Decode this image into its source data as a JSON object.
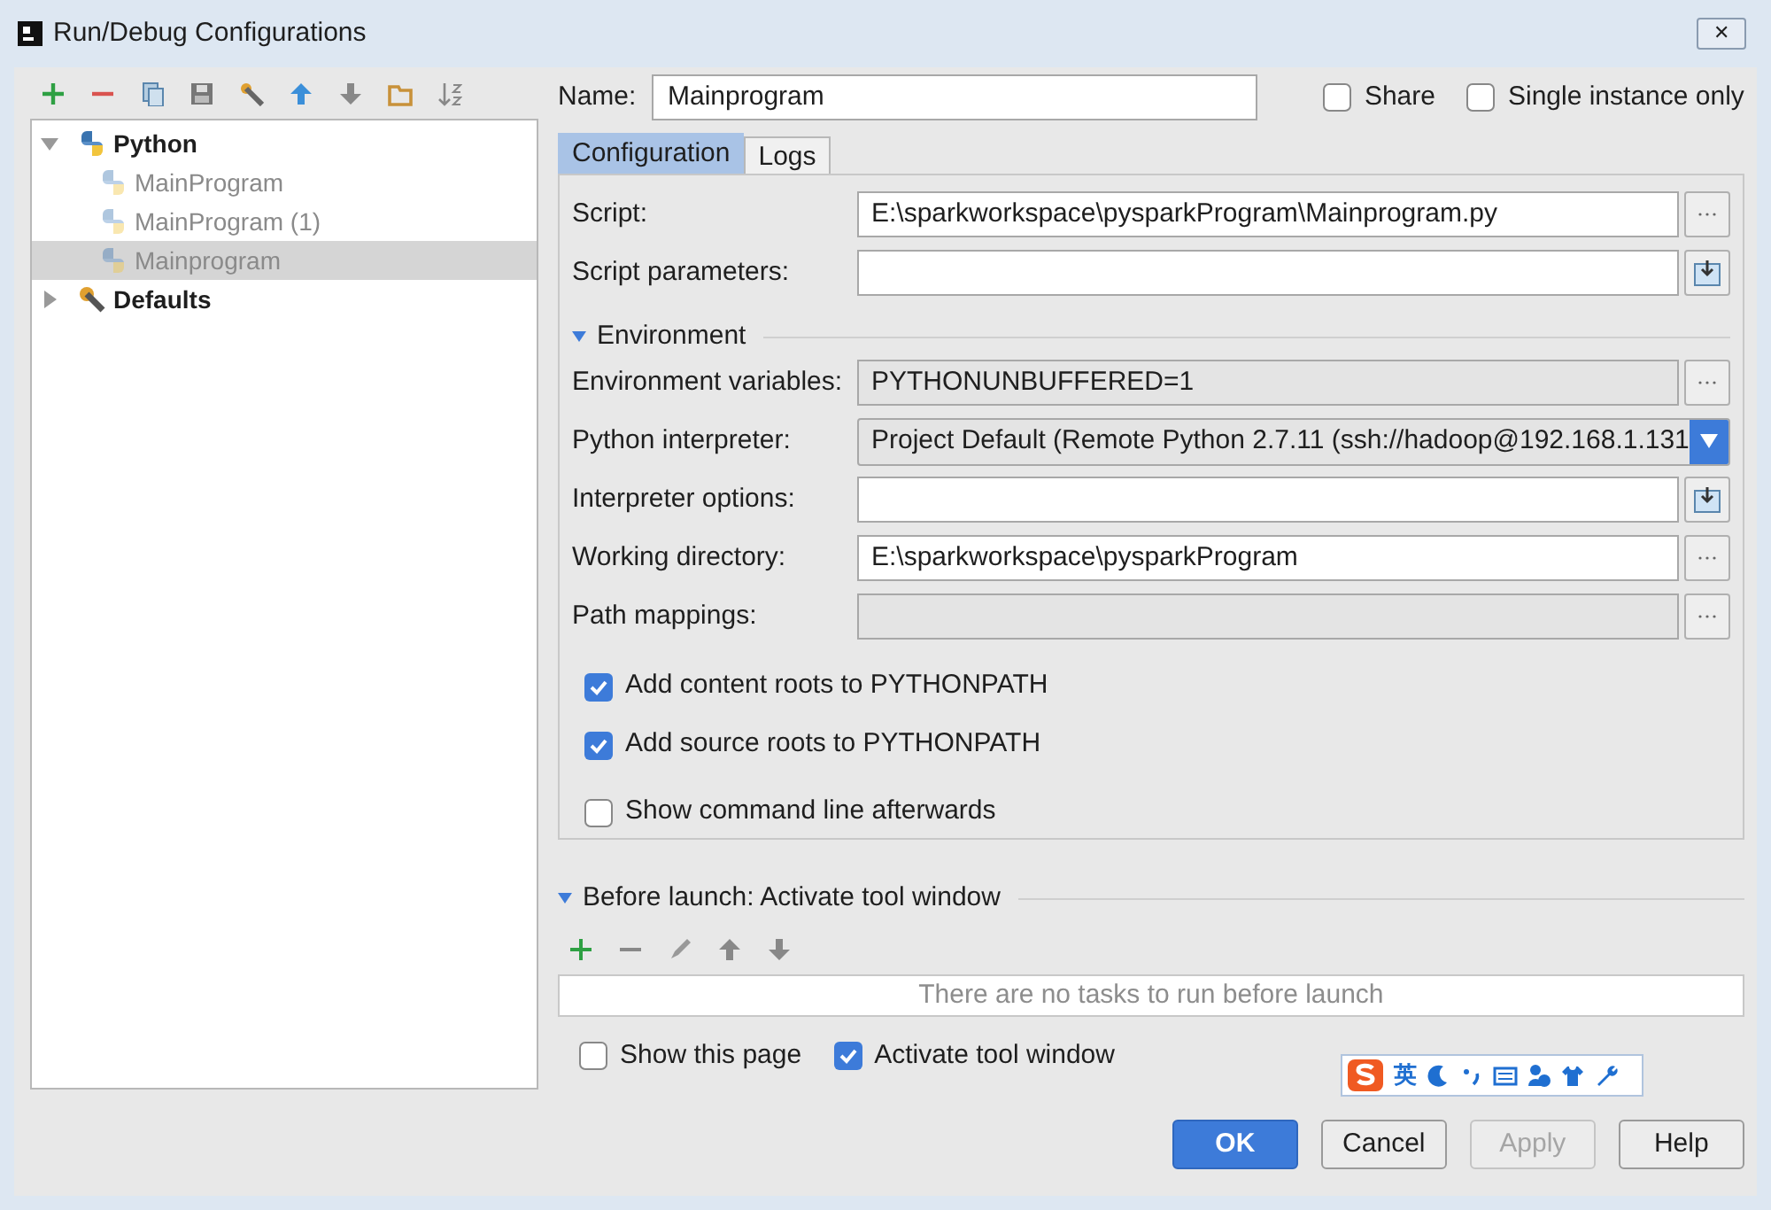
{
  "window": {
    "title": "Run/Debug Configurations",
    "close": "✕"
  },
  "tree": [
    {
      "label": "Python",
      "kind": "group",
      "expanded": true,
      "selected": false,
      "children": [
        {
          "label": "MainProgram",
          "kind": "config",
          "selected": false
        },
        {
          "label": "MainProgram (1)",
          "kind": "config",
          "selected": false
        },
        {
          "label": "Mainprogram",
          "kind": "config",
          "selected": true
        }
      ]
    },
    {
      "label": "Defaults",
      "kind": "defaults",
      "expanded": false,
      "selected": false
    }
  ],
  "name": {
    "label": "Name:",
    "value": "Mainprogram"
  },
  "options": [
    {
      "label": "Share",
      "checked": false
    },
    {
      "label": "Single instance only",
      "checked": false
    }
  ],
  "tabs": [
    {
      "label": "Configuration",
      "selected": true
    },
    {
      "label": "Logs",
      "selected": false
    }
  ],
  "fields": [
    {
      "label": "Script:",
      "value": "E:\\sparkworkspace\\pysparkProgram\\Mainprogram.py",
      "kind": "text",
      "browse_button": true
    },
    {
      "label": "Script parameters:",
      "kind": "text",
      "expand_button": true
    }
  ],
  "environment": {
    "label": "Environment",
    "expanded": true,
    "fields": [
      {
        "label": "Environment variables:",
        "value": "PYTHONUNBUFFERED=1",
        "kind": "readonly",
        "browse_button": true
      },
      {
        "label": "Python interpreter:",
        "value": "Project Default (Remote Python 2.7.11 (ssh://hadoop@192.168.1.131",
        "kind": "dropdown"
      },
      {
        "label": "Interpreter options:",
        "kind": "text",
        "expand_button": true
      },
      {
        "label": "Working directory:",
        "value": "E:\\sparkworkspace\\pysparkProgram",
        "kind": "text",
        "browse_button": true
      },
      {
        "label": "Path mappings:",
        "kind": "readonly",
        "browse_button": true
      }
    ]
  },
  "checkboxes": [
    {
      "label": "Add content roots to PYTHONPATH",
      "checked": true
    },
    {
      "label": "Add source roots to PYTHONPATH",
      "checked": true
    },
    {
      "label": "Show command line afterwards",
      "checked": false
    }
  ],
  "before_launch": {
    "label": "Before launch: Activate tool window",
    "expanded": true,
    "empty_text": "There are no tasks to run before launch"
  },
  "bottom_checkboxes": [
    {
      "label": "Show this page",
      "checked": false
    },
    {
      "label": "Activate tool window",
      "checked": true
    }
  ],
  "ime_toolbar": {
    "mode": "英"
  },
  "buttons": [
    {
      "label": "OK",
      "kind": "default",
      "disabled": false
    },
    {
      "label": "Cancel",
      "kind": "normal",
      "disabled": false
    },
    {
      "label": "Apply",
      "kind": "normal",
      "disabled": true
    },
    {
      "label": "Help",
      "kind": "normal",
      "disabled": false
    }
  ]
}
